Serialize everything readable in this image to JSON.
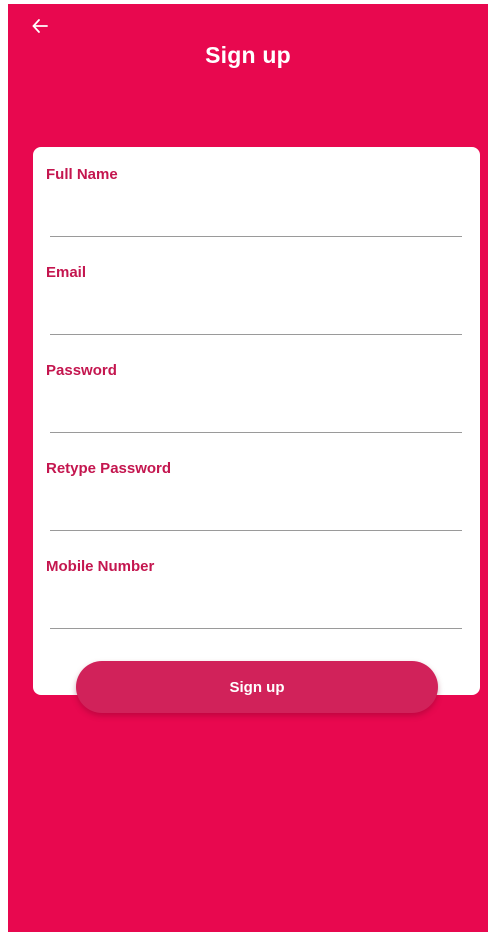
{
  "header": {
    "title": "Sign up",
    "back_icon": "arrow-left-icon"
  },
  "form": {
    "fields": [
      {
        "label": "Full Name",
        "value": ""
      },
      {
        "label": "Email",
        "value": ""
      },
      {
        "label": "Password",
        "value": ""
      },
      {
        "label": "Retype Password",
        "value": ""
      },
      {
        "label": "Mobile Number",
        "value": ""
      }
    ],
    "submit_label": "Sign up"
  },
  "colors": {
    "background": "#e8084f",
    "card": "#ffffff",
    "label": "#c4164f",
    "button": "#d1225a"
  }
}
